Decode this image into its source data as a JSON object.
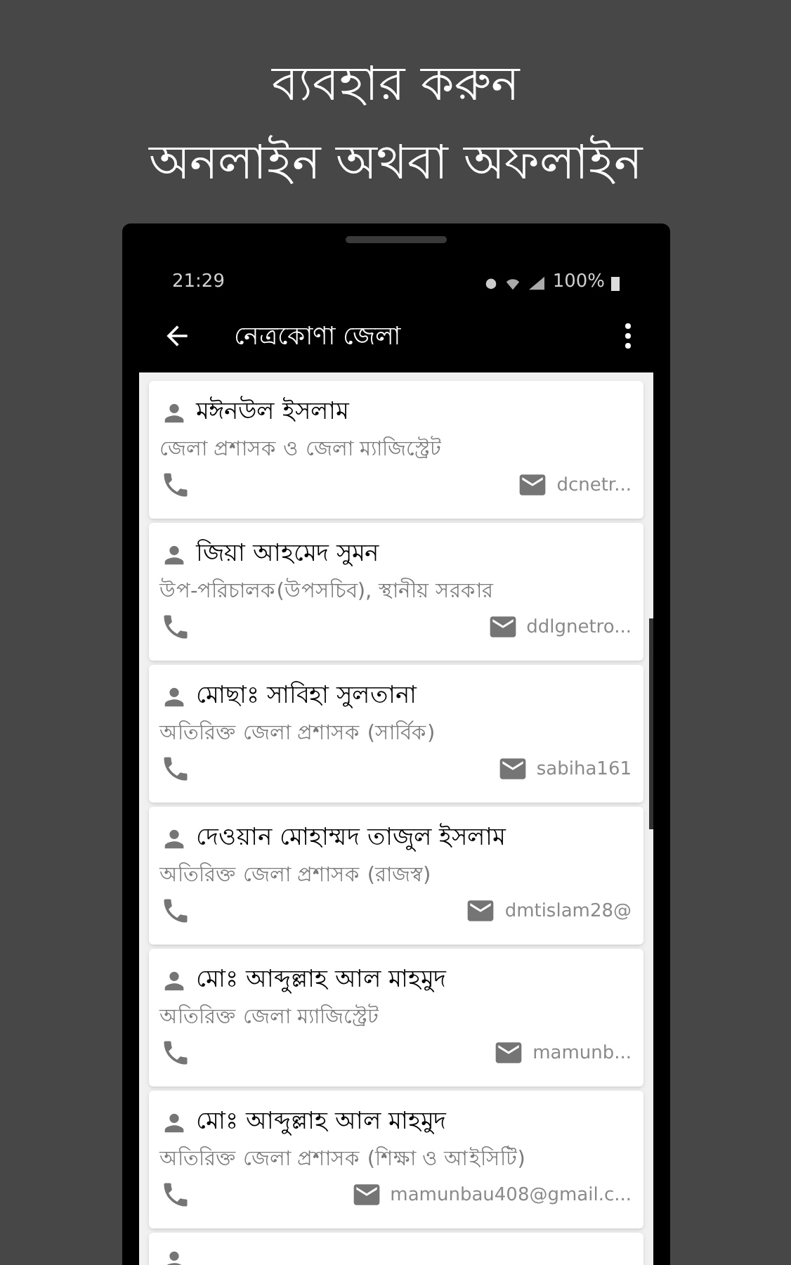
{
  "headline": [
    "ব্যবহার করুন",
    "অনলাইন অথবা অফলাইন"
  ],
  "status_bar": {
    "time": "21:29",
    "battery": "100%"
  },
  "app_bar": {
    "title": "নেত্রকোণা জেলা"
  },
  "contacts": [
    {
      "name": "মঈনউল ইসলাম",
      "designation": "জেলা প্রশাসক ও জেলা ম্যাজিস্ট্রেট",
      "email": "dcnetr..."
    },
    {
      "name": "জিয়া আহমেদ সুমন",
      "designation": "উপ-পরিচালক(উপসচিব), স্থানীয় সরকার",
      "email": "ddlgnetro..."
    },
    {
      "name": "মোছাঃ সাবিহা সুলতানা",
      "designation": "অতিরিক্ত জেলা প্রশাসক (সার্বিক)",
      "email": "sabiha161"
    },
    {
      "name": "দেওয়ান মোহাম্মদ তাজুল ইসলাম",
      "designation": "অতিরিক্ত জেলা প্রশাসক (রাজস্ব)",
      "email": "dmtislam28@"
    },
    {
      "name": "মোঃ আব্দুল্লাহ আল মাহমুদ",
      "designation": "অতিরিক্ত জেলা ম্যাজিস্ট্রেট",
      "email": "mamunb..."
    },
    {
      "name": "মোঃ আব্দুল্লাহ আল মাহমুদ",
      "designation": "অতিরিক্ত জেলা প্রশাসক (শিক্ষা ও আইসিটি)",
      "email": "mamunbau408@gmail.c..."
    }
  ]
}
